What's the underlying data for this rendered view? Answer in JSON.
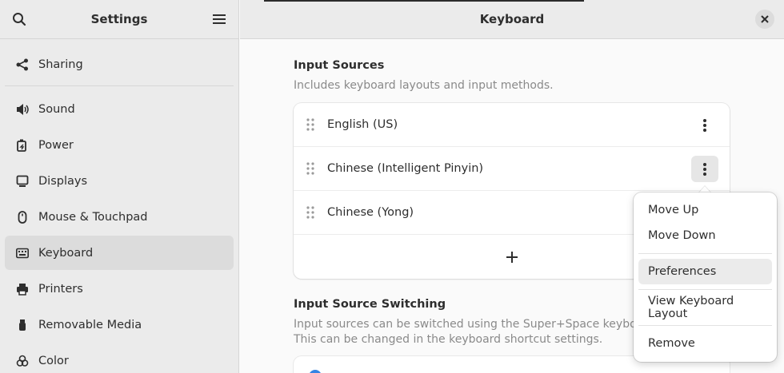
{
  "sidebar": {
    "title": "Settings",
    "items": [
      {
        "label": "Sharing",
        "icon": "share-icon"
      },
      {
        "label": "Sound",
        "icon": "speaker-icon"
      },
      {
        "label": "Power",
        "icon": "battery-icon"
      },
      {
        "label": "Displays",
        "icon": "display-icon"
      },
      {
        "label": "Mouse & Touchpad",
        "icon": "mouse-icon"
      },
      {
        "label": "Keyboard",
        "icon": "keyboard-icon",
        "active": true
      },
      {
        "label": "Printers",
        "icon": "printer-icon"
      },
      {
        "label": "Removable Media",
        "icon": "usb-icon"
      },
      {
        "label": "Color",
        "icon": "palette-icon"
      }
    ]
  },
  "header": {
    "title": "Keyboard"
  },
  "input_sources": {
    "title": "Input Sources",
    "subtitle": "Includes keyboard layouts and input methods.",
    "rows": [
      "English (US)",
      "Chinese (Intelligent Pinyin)",
      "Chinese (Yong)"
    ]
  },
  "switching": {
    "title": "Input Source Switching",
    "subtitle_line1": "Input sources can be switched using the Super+Space keyboard sh",
    "subtitle_line2": "This can be changed in the keyboard shortcut settings."
  },
  "menu": {
    "items": [
      "Move Up",
      "Move Down",
      "Preferences",
      "View Keyboard Layout",
      "Remove"
    ]
  },
  "colors": {
    "accent": "#3584e4",
    "sidebar_bg": "#ebebeb",
    "content_bg": "#fafafa"
  }
}
